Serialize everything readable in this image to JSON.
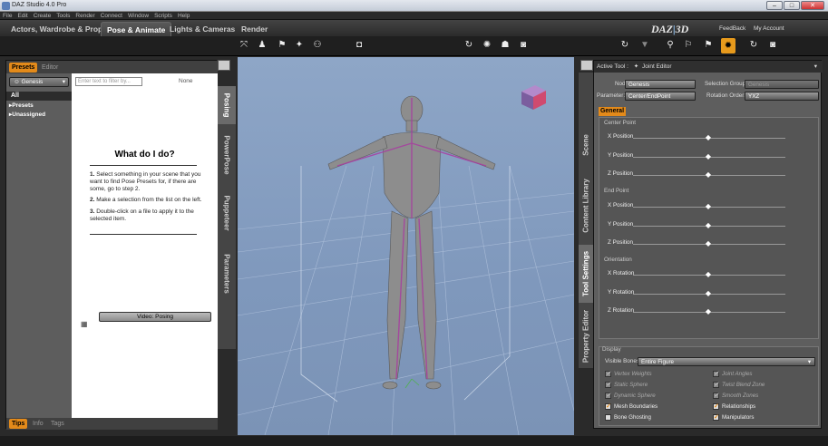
{
  "window": {
    "title": "DAZ Studio 4.0 Pro"
  },
  "menu": [
    "File",
    "Edit",
    "Create",
    "Tools",
    "Render",
    "Connect",
    "Window",
    "Scripts",
    "Help"
  ],
  "nav_tabs": [
    {
      "label": "Actors, Wardrobe & Props",
      "active": false
    },
    {
      "label": "Pose & Animate",
      "active": true
    },
    {
      "label": "Lights & Cameras",
      "active": false
    },
    {
      "label": "Render",
      "active": false
    }
  ],
  "brand": {
    "logo": "DAZ|3D",
    "feedback": "FeedBack",
    "account": "My Account"
  },
  "colors": {
    "accent": "#e38a1a",
    "viewport_bg": "#8ea6c7"
  },
  "left_panel": {
    "tabs": [
      "Presets",
      "Editor"
    ],
    "figure_select": "Genesis",
    "filter_placeholder": "Enter text to filter by...",
    "none_label": "None",
    "categories": [
      "All",
      "Presets",
      "Unassigned"
    ],
    "help": {
      "title": "What do I do?",
      "steps": [
        {
          "num": "1.",
          "text": "Select something in your scene that you want to find Pose Presets for, if there are some, go to step 2."
        },
        {
          "num": "2.",
          "text": "Make a selection from the list on the left."
        },
        {
          "num": "3.",
          "text": "Double-click on a file to apply it to the selected item."
        }
      ],
      "video_button": "Video: Posing"
    },
    "side_tabs": [
      "Posing",
      "PowerPose",
      "Puppeteer",
      "Parameters"
    ],
    "bottom_tabs": [
      "Tips",
      "Info",
      "Tags"
    ]
  },
  "right_panel": {
    "active_tool_label": "Active Tool :",
    "active_tool": "Joint Editor",
    "node_label": "Node:",
    "node_value": "Genesis",
    "selection_group_label": "Selection Group:",
    "selection_group_value": "Genesis",
    "parameter_label": "Parameter:",
    "parameter_value": "Center/EndPoint",
    "rotation_order_label": "Rotation Order:",
    "rotation_order_value": "YXZ",
    "general_tab": "General",
    "sections": [
      {
        "title": "Center Point",
        "params": [
          "X Position",
          "Y Position",
          "Z Position"
        ]
      },
      {
        "title": "End Point",
        "params": [
          "X Position",
          "Y Position",
          "Z Position"
        ]
      },
      {
        "title": "Orientation",
        "params": [
          "X Rotation",
          "Y Rotation",
          "Z Rotation"
        ]
      }
    ],
    "side_tabs": [
      "Scene",
      "Content Library",
      "Tool Settings",
      "Property Editor"
    ],
    "display": {
      "title": "Display",
      "visible_bones_label": "Visible Bones:",
      "visible_bones_value": "Entire Figure",
      "options": [
        {
          "label": "Vertex Weights",
          "checked": true,
          "enabled": false
        },
        {
          "label": "Joint Angles",
          "checked": true,
          "enabled": false
        },
        {
          "label": "Static Sphere",
          "checked": true,
          "enabled": false
        },
        {
          "label": "Twist Blend Zone",
          "checked": true,
          "enabled": false
        },
        {
          "label": "Dynamic Sphere",
          "checked": true,
          "enabled": false
        },
        {
          "label": "Smooth Zones",
          "checked": true,
          "enabled": false
        },
        {
          "label": "Mesh Boundaries",
          "checked": true,
          "enabled": true
        },
        {
          "label": "Relationships",
          "checked": true,
          "enabled": true
        },
        {
          "label": "Bone Ghosting",
          "checked": false,
          "enabled": true
        },
        {
          "label": "Manipulators",
          "checked": true,
          "enabled": true
        }
      ]
    }
  }
}
